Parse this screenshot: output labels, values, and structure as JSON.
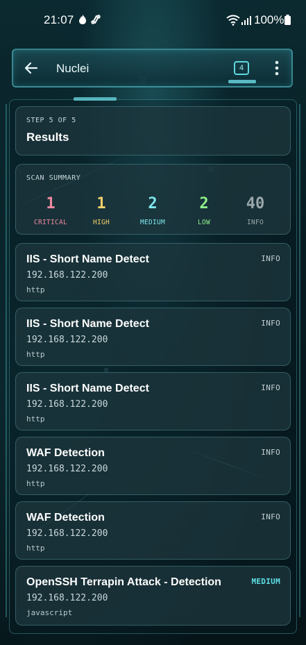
{
  "status_bar": {
    "time": "21:07",
    "battery": "100%"
  },
  "app_bar": {
    "title": "Nuclei",
    "tab_count": "4"
  },
  "step": {
    "label": "STEP 5 OF 5",
    "title": "Results"
  },
  "summary": {
    "label": "SCAN SUMMARY",
    "stats": [
      {
        "value": "1",
        "label": "CRITICAL",
        "color": "#f08aa0"
      },
      {
        "value": "1",
        "label": "HIGH",
        "color": "#f2d06b"
      },
      {
        "value": "2",
        "label": "MEDIUM",
        "color": "#7fe6ee"
      },
      {
        "value": "2",
        "label": "LOW",
        "color": "#8ef08a"
      },
      {
        "value": "40",
        "label": "INFO",
        "color": "#9aa8ab"
      }
    ]
  },
  "findings": [
    {
      "title": "IIS - Short Name Detect",
      "severity": "INFO",
      "host": "192.168.122.200",
      "protocol": "http",
      "severity_color": "#c4d0d2"
    },
    {
      "title": "IIS - Short Name Detect",
      "severity": "INFO",
      "host": "192.168.122.200",
      "protocol": "http",
      "severity_color": "#c4d0d2"
    },
    {
      "title": "IIS - Short Name Detect",
      "severity": "INFO",
      "host": "192.168.122.200",
      "protocol": "http",
      "severity_color": "#c4d0d2"
    },
    {
      "title": "WAF Detection",
      "severity": "INFO",
      "host": "192.168.122.200",
      "protocol": "http",
      "severity_color": "#c4d0d2"
    },
    {
      "title": "WAF Detection",
      "severity": "INFO",
      "host": "192.168.122.200",
      "protocol": "http",
      "severity_color": "#c4d0d2"
    },
    {
      "title": "OpenSSH Terrapin Attack - Detection",
      "severity": "MEDIUM",
      "host": "192.168.122.200",
      "protocol": "javascript",
      "severity_color": "#5fe0e6"
    }
  ],
  "colors": {
    "accent": "#5fd8de",
    "card_bg": "#1e383e",
    "background": "#061418"
  }
}
